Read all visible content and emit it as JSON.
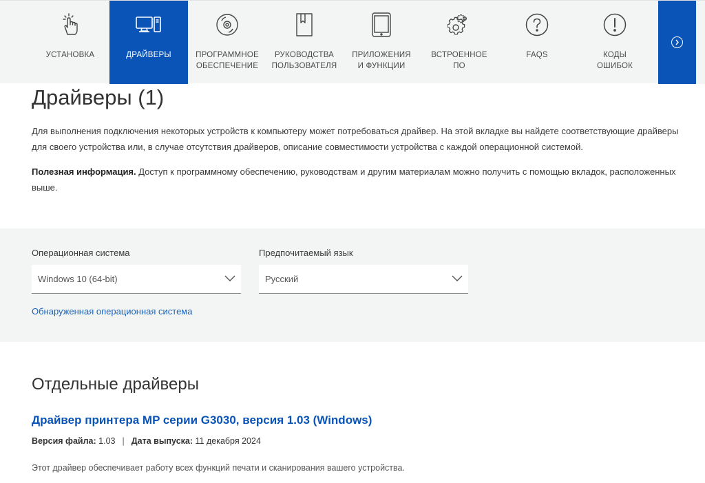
{
  "tabs": [
    {
      "label_line1": "УСТАНОВКА",
      "label_line2": "",
      "icon": "hand-pointer-icon",
      "active": false
    },
    {
      "label_line1": "ДРАЙВЕРЫ",
      "label_line2": "",
      "icon": "computer-icon",
      "active": true
    },
    {
      "label_line1": "ПРОГРАММНОЕ",
      "label_line2": "ОБЕСПЕЧЕНИЕ",
      "icon": "disc-icon",
      "active": false
    },
    {
      "label_line1": "РУКОВОДСТВА",
      "label_line2": "ПОЛЬЗОВАТЕЛЯ",
      "icon": "document-icon",
      "active": false
    },
    {
      "label_line1": "ПРИЛОЖЕНИЯ",
      "label_line2": "И ФУНКЦИИ",
      "icon": "tablet-icon",
      "active": false
    },
    {
      "label_line1": "ВСТРОЕННОЕ",
      "label_line2": "ПО",
      "icon": "gears-icon",
      "active": false
    },
    {
      "label_line1": "FAQS",
      "label_line2": "",
      "icon": "question-icon",
      "active": false
    },
    {
      "label_line1": "КОДЫ",
      "label_line2": "ОШИБОК",
      "icon": "exclamation-icon",
      "active": false
    }
  ],
  "next_tab_icon": "chevron-right-icon",
  "page": {
    "title": "Драйверы (1)",
    "intro": "Для выполнения подключения некоторых устройств к компьютеру может потребоваться драйвер. На этой вкладке вы найдете соответствующие драйверы для своего устройства или, в случае отсутствия драйверов, описание совместимости устройства с каждой операционной системой.",
    "useful_label": "Полезная информация.",
    "useful_text": " Доступ к программному обеспечению, руководствам и другим материалам можно получить с помощью вкладок, расположенных выше."
  },
  "filters": {
    "os_label": "Операционная система",
    "os_value": "Windows 10 (64-bit)",
    "lang_label": "Предпочитаемый язык",
    "lang_value": "Русский",
    "detect_link": "Обнаруженная операционная система"
  },
  "section": {
    "heading": "Отдельные драйверы"
  },
  "driver": {
    "title": "Драйвер принтера MP серии G3030, версия 1.03 (Windows)",
    "version_label": "Версия файла:",
    "version_value": "1.03",
    "separator": "|",
    "date_label": "Дата выпуска:",
    "date_value": "11 декабря 2024",
    "description": "Этот драйвер обеспечивает работу всех функций печати и сканирования вашего устройства."
  },
  "colors": {
    "accent": "#0a54b8",
    "link": "#1b63b8",
    "panel": "#f3f4f4"
  }
}
